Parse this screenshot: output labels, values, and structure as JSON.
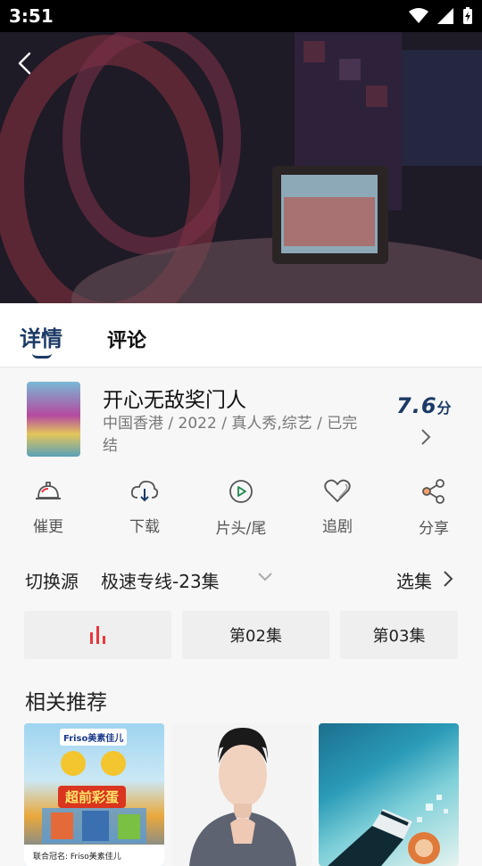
{
  "status_bar": {
    "time": "3:51"
  },
  "tabs": [
    {
      "label": "详情"
    },
    {
      "label": "评论"
    }
  ],
  "show": {
    "title": "开心无敌奖门人",
    "meta": "中国香港 / 2022 / 真人秀,综艺 / 已完结",
    "score": "7.6",
    "score_unit": "分"
  },
  "actions": [
    {
      "label": "催更",
      "icon": "bell-icon"
    },
    {
      "label": "下载",
      "icon": "cloud-download-icon"
    },
    {
      "label": "片头/尾",
      "icon": "play-circle-icon"
    },
    {
      "label": "追剧",
      "icon": "heart-icon"
    },
    {
      "label": "分享",
      "icon": "share-icon"
    }
  ],
  "source": {
    "label": "切换源",
    "value": "极速专线-23集",
    "select_label": "选集"
  },
  "episodes": [
    {
      "label": "",
      "playing": true
    },
    {
      "label": "第02集"
    },
    {
      "label": "第03集"
    }
  ],
  "recommend": {
    "title": "相关推荐",
    "cards": [
      {
        "brand": "Friso美素佳儿",
        "banner": "超前彩蛋",
        "footer": "联合冠名: Friso美素佳儿"
      },
      {},
      {}
    ]
  },
  "colors": {
    "accent": "#1c3a66",
    "playing": "#e8363f"
  }
}
